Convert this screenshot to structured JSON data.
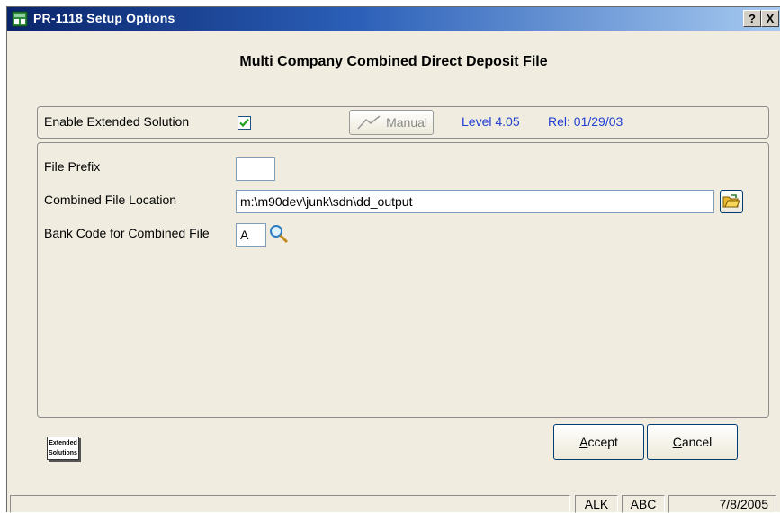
{
  "window": {
    "title": "PR-1118  Setup Options",
    "help_label": "?",
    "close_label": "X"
  },
  "heading": "Multi Company Combined Direct Deposit File",
  "solution": {
    "enable_label": "Enable Extended Solution",
    "enabled": true,
    "manual_label": "Manual",
    "level": "Level 4.05",
    "release": "Rel: 01/29/03"
  },
  "fields": {
    "file_prefix": {
      "label": "File Prefix",
      "value": ""
    },
    "location": {
      "label": "Combined File Location",
      "value": "m:\\m90dev\\junk\\sdn\\dd_output"
    },
    "bank_code": {
      "label": "Bank Code for Combined File",
      "value": "A"
    }
  },
  "buttons": {
    "accept": {
      "first": "A",
      "rest": "ccept"
    },
    "cancel": {
      "first": "C",
      "rest": "ancel"
    }
  },
  "logo": {
    "line1": "Extended",
    "line2": "Solutions"
  },
  "status": {
    "user": "ALK",
    "company": "ABC",
    "date": "7/8/2005"
  },
  "colors": {
    "accent": "#1f3fd0",
    "window_bg": "#f0ede0",
    "title_start": "#0a246a",
    "title_end": "#a6caf0"
  }
}
